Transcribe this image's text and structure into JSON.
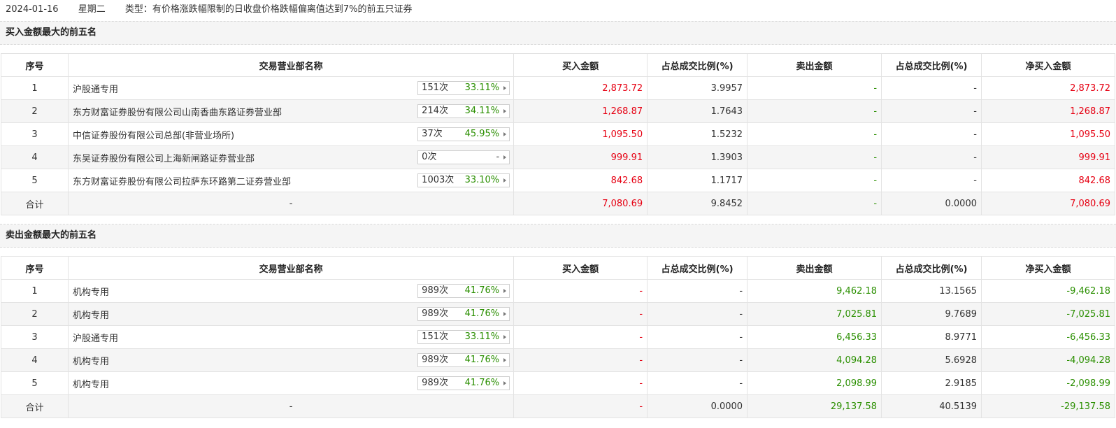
{
  "header": {
    "date": "2024-01-16",
    "weekday": "星期二",
    "type_text": "类型：有价格涨跌幅限制的日收盘价格跌幅偏离值达到7%的前五只证券"
  },
  "colors": {
    "red": "#e60012",
    "green": "#2a8f00"
  },
  "columns": [
    "序号",
    "交易营业部名称",
    "买入金额",
    "占总成交比例(%)",
    "卖出金额",
    "占总成交比例(%)",
    "净买入金额"
  ],
  "buy_section": {
    "title": "买入金额最大的前五名",
    "rows": [
      {
        "idx": "1",
        "name": "沪股通专用",
        "times": "151次",
        "pct": "33.11%",
        "buy": "2,873.72",
        "buy_ratio": "3.9957",
        "sell": "-",
        "sell_ratio": "-",
        "net": "2,873.72"
      },
      {
        "idx": "2",
        "name": "东方财富证券股份有限公司山南香曲东路证券营业部",
        "times": "214次",
        "pct": "34.11%",
        "buy": "1,268.87",
        "buy_ratio": "1.7643",
        "sell": "-",
        "sell_ratio": "-",
        "net": "1,268.87"
      },
      {
        "idx": "3",
        "name": "中信证券股份有限公司总部(非营业场所)",
        "times": "37次",
        "pct": "45.95%",
        "buy": "1,095.50",
        "buy_ratio": "1.5232",
        "sell": "-",
        "sell_ratio": "-",
        "net": "1,095.50"
      },
      {
        "idx": "4",
        "name": "东吴证券股份有限公司上海新闸路证券营业部",
        "times": "0次",
        "pct": "-",
        "buy": "999.91",
        "buy_ratio": "1.3903",
        "sell": "-",
        "sell_ratio": "-",
        "net": "999.91"
      },
      {
        "idx": "5",
        "name": "东方财富证券股份有限公司拉萨东环路第二证券营业部",
        "times": "1003次",
        "pct": "33.10%",
        "buy": "842.68",
        "buy_ratio": "1.1717",
        "sell": "-",
        "sell_ratio": "-",
        "net": "842.68"
      }
    ],
    "total": {
      "label": "合计",
      "name": "-",
      "buy": "7,080.69",
      "buy_ratio": "9.8452",
      "sell": "-",
      "sell_ratio": "0.0000",
      "net": "7,080.69"
    }
  },
  "sell_section": {
    "title": "卖出金额最大的前五名",
    "rows": [
      {
        "idx": "1",
        "name": "机构专用",
        "times": "989次",
        "pct": "41.76%",
        "buy": "-",
        "buy_ratio": "-",
        "sell": "9,462.18",
        "sell_ratio": "13.1565",
        "net": "-9,462.18"
      },
      {
        "idx": "2",
        "name": "机构专用",
        "times": "989次",
        "pct": "41.76%",
        "buy": "-",
        "buy_ratio": "-",
        "sell": "7,025.81",
        "sell_ratio": "9.7689",
        "net": "-7,025.81"
      },
      {
        "idx": "3",
        "name": "沪股通专用",
        "times": "151次",
        "pct": "33.11%",
        "buy": "-",
        "buy_ratio": "-",
        "sell": "6,456.33",
        "sell_ratio": "8.9771",
        "net": "-6,456.33"
      },
      {
        "idx": "4",
        "name": "机构专用",
        "times": "989次",
        "pct": "41.76%",
        "buy": "-",
        "buy_ratio": "-",
        "sell": "4,094.28",
        "sell_ratio": "5.6928",
        "net": "-4,094.28"
      },
      {
        "idx": "5",
        "name": "机构专用",
        "times": "989次",
        "pct": "41.76%",
        "buy": "-",
        "buy_ratio": "-",
        "sell": "2,098.99",
        "sell_ratio": "2.9185",
        "net": "-2,098.99"
      }
    ],
    "total": {
      "label": "合计",
      "name": "-",
      "buy": "-",
      "buy_ratio": "0.0000",
      "sell": "29,137.58",
      "sell_ratio": "40.5139",
      "net": "-29,137.58"
    }
  }
}
